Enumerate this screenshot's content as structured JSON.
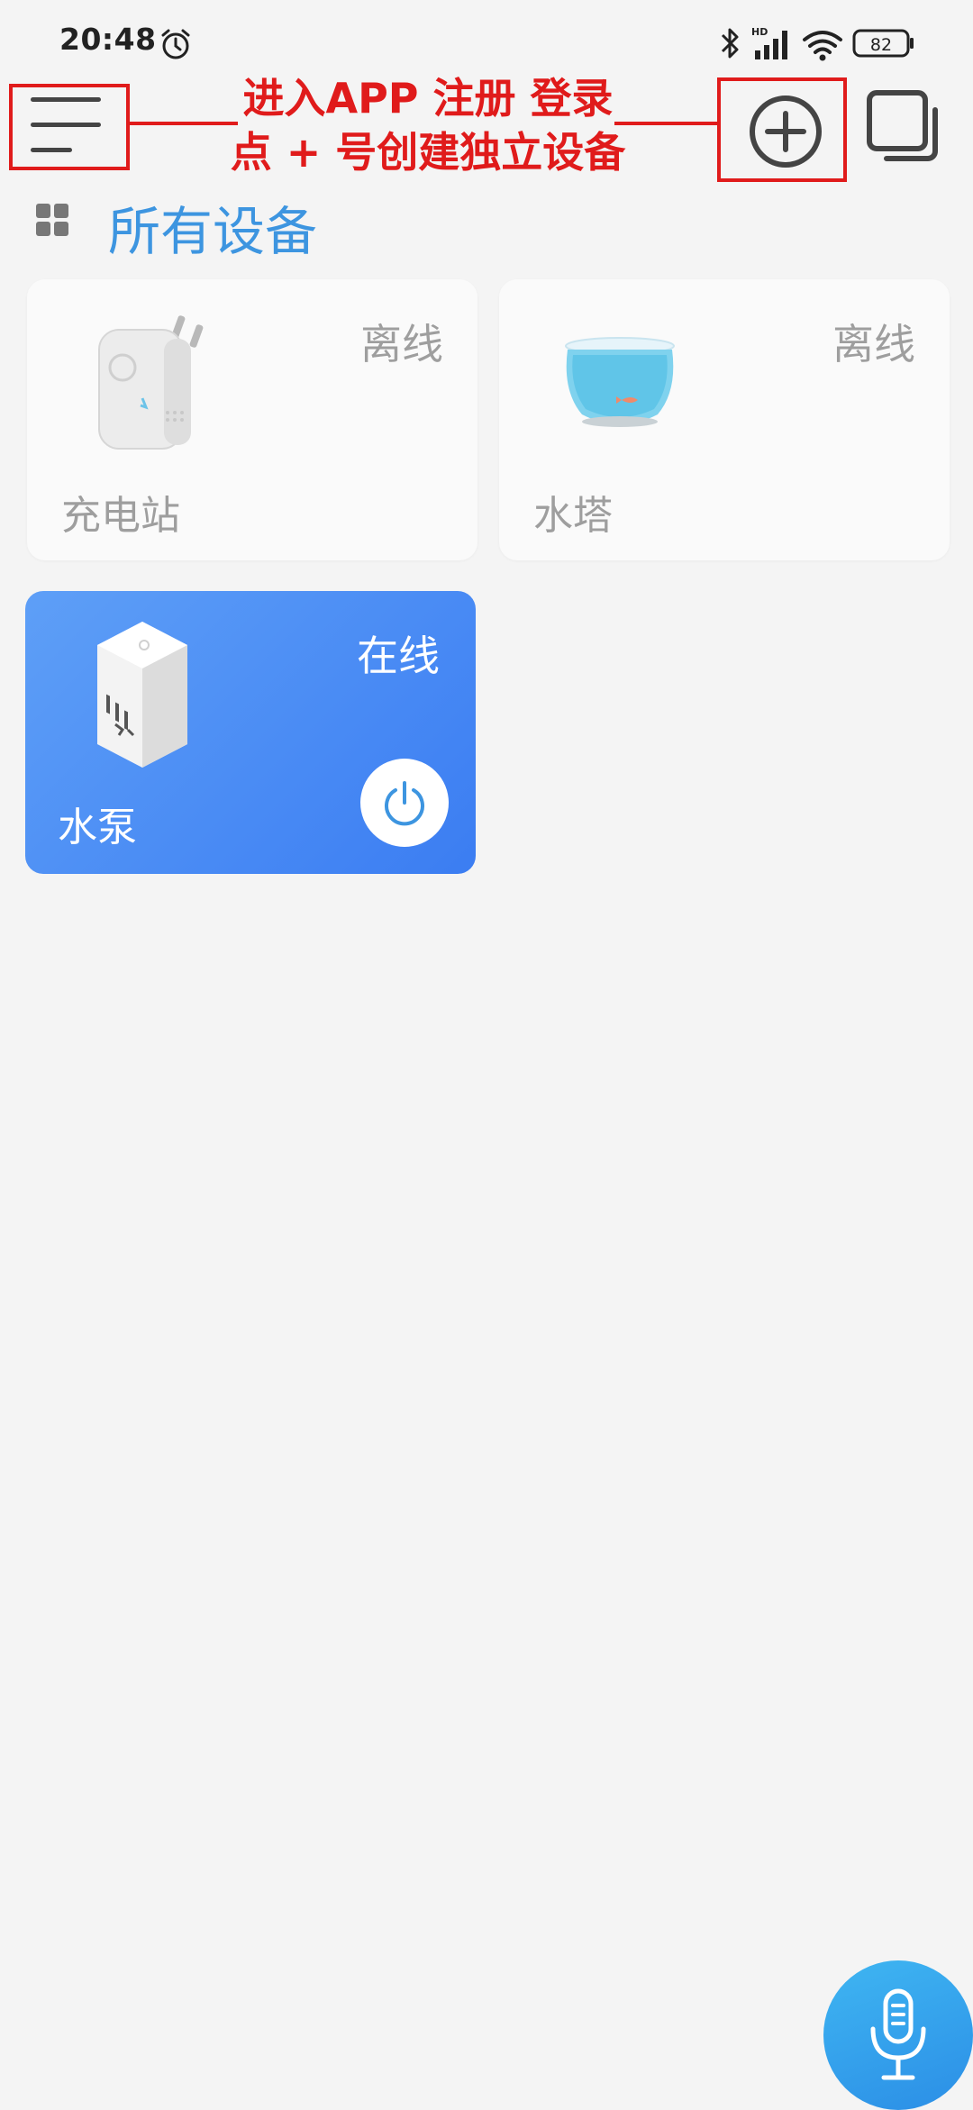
{
  "status_bar": {
    "time": "20:48",
    "battery": "82",
    "hd_label": "HD",
    "icons": [
      "alarm-icon",
      "bluetooth-icon",
      "signal-icon",
      "wifi-icon",
      "battery-icon"
    ]
  },
  "annotation": {
    "line1": "进入APP 注册 登录",
    "line2": "点 + 号创建独立设备",
    "color": "#e01b1b"
  },
  "header": {
    "menu_icon": "menu-icon",
    "add_icon": "add-icon",
    "multi_icon": "multi-window-icon"
  },
  "section": {
    "title": "所有设备",
    "title_color": "#3d95e0"
  },
  "devices": [
    {
      "name": "充电站",
      "status": "离线",
      "icon": "plug-adapter-icon"
    },
    {
      "name": "水塔",
      "status": "离线",
      "icon": "fish-bowl-icon"
    },
    {
      "name": "水泵",
      "status": "在线",
      "icon": "smart-socket-icon",
      "active": true
    }
  ],
  "accent_colors": {
    "active_card": "#3b7df2",
    "fab": "#2b8ee6"
  }
}
